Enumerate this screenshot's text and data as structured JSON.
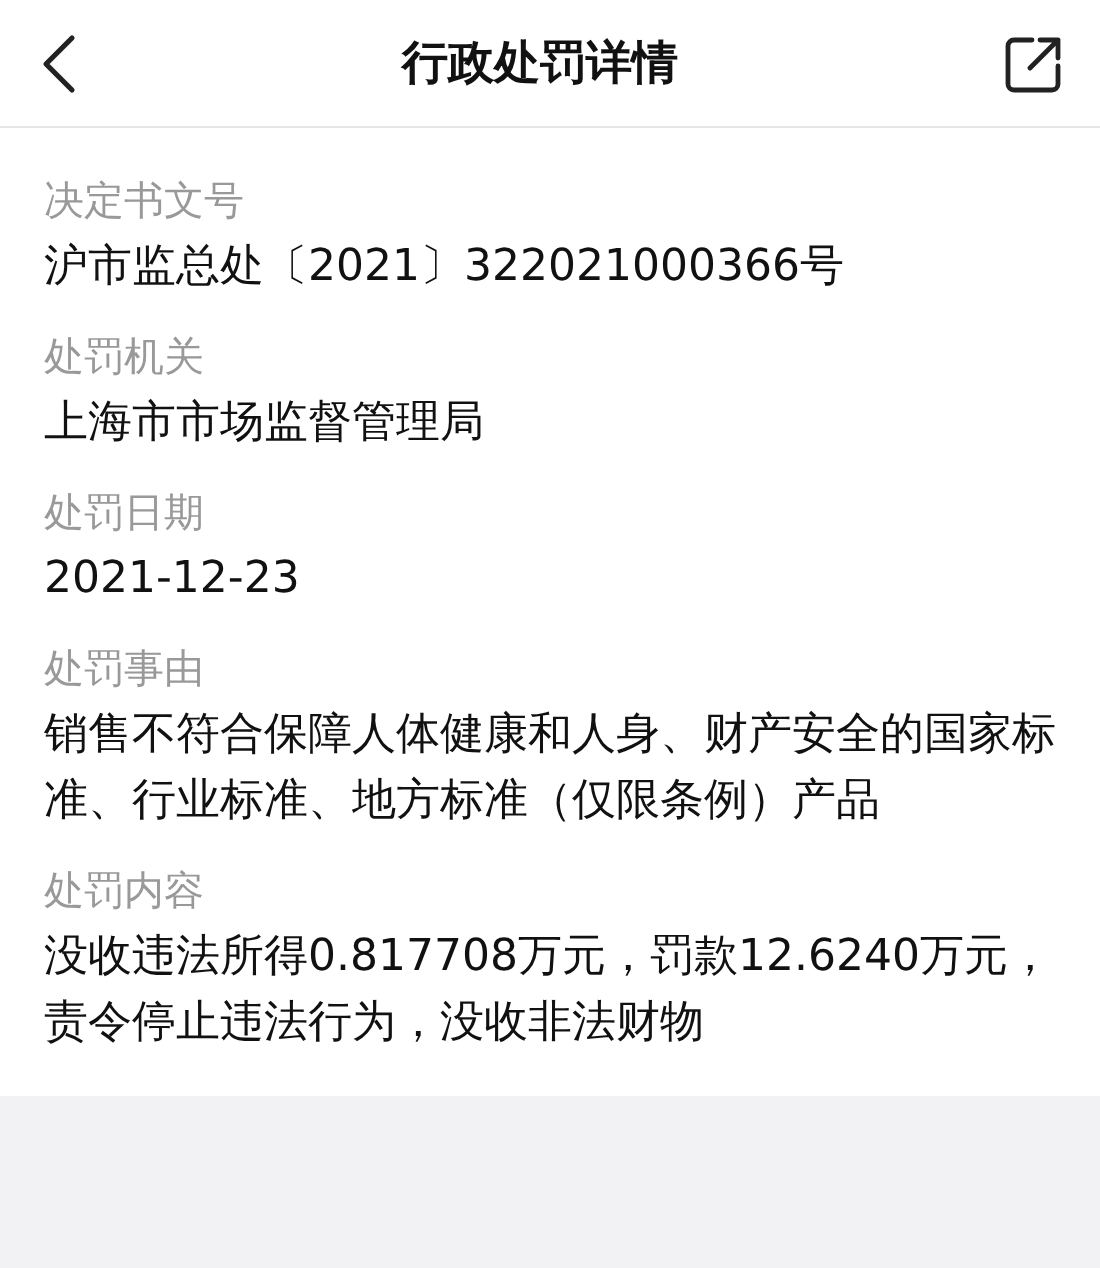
{
  "header": {
    "title": "行政处罚详情"
  },
  "fields": [
    {
      "label": "决定书文号",
      "value": "沪市监总处〔2021〕322021000366号"
    },
    {
      "label": "处罚机关",
      "value": "上海市市场监督管理局"
    },
    {
      "label": "处罚日期",
      "value": "2021-12-23"
    },
    {
      "label": "处罚事由",
      "value": "销售不符合保障人体健康和人身、财产安全的国家标准、行业标准、地方标准（仅限条例）产品"
    },
    {
      "label": "处罚内容",
      "value": "没收违法所得0.817708万元，罚款12.6240万元，责令停止违法行为，没收非法财物"
    }
  ]
}
